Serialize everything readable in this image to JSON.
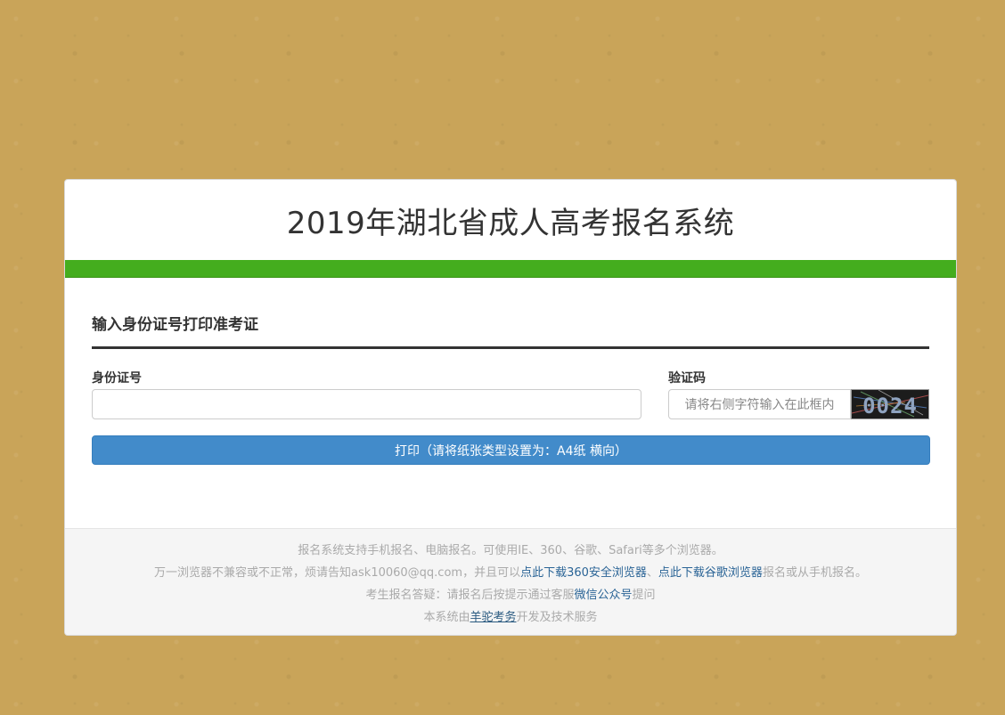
{
  "header": {
    "title": "2019年湖北省成人高考报名系统"
  },
  "colors": {
    "background": "#c9a459",
    "accent_bar": "#44ad1e",
    "primary_button": "#428bca"
  },
  "form": {
    "section_title": "输入身份证号打印准考证",
    "id_label": "身份证号",
    "id_value": "",
    "captcha_label": "验证码",
    "captcha_placeholder": "请将右侧字符输入在此框内",
    "captcha_value": "",
    "captcha_image_text": "0024",
    "print_button": "打印（请将纸张类型设置为：A4纸 横向）"
  },
  "footer": {
    "line1": "报名系统支持手机报名、电脑报名。可使用IE、360、谷歌、Safari等多个浏览器。",
    "line2_prefix": "万一浏览器不兼容或不正常，烦请告知ask10060@qq.com，并且可以",
    "line2_link1": "点此下载360安全浏览器",
    "line2_sep": "、",
    "line2_link2": "点此下载谷歌浏览器",
    "line2_suffix": "报名或从手机报名。",
    "line3_prefix": "考生报名答疑：请报名后按提示通过客服",
    "line3_link": "微信公众号",
    "line3_suffix": "提问",
    "line4_prefix": "本系统由",
    "line4_link": "羊驼考务",
    "line4_suffix": "开发及技术服务"
  }
}
